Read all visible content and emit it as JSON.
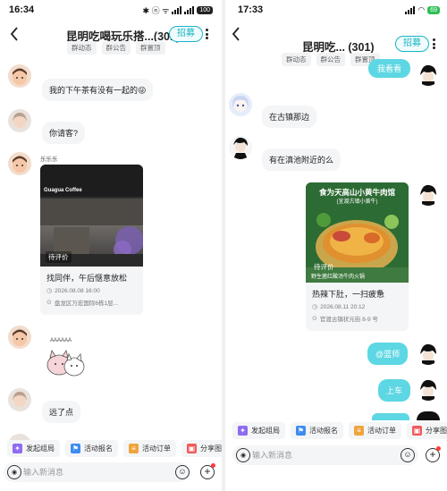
{
  "left": {
    "status": {
      "time": "16:34",
      "icons": "✱ ⓝ ᯤ",
      "battery": "100"
    },
    "header": {
      "title": "昆明吃喝玩乐搭...(301)",
      "recruit_label": "招募",
      "chips": [
        "群动态",
        "群公告",
        "群置顶"
      ]
    },
    "messages": [
      {
        "type": "text",
        "text": "我的下午茶有没有一起的😜"
      },
      {
        "type": "text",
        "text": "你请客?"
      },
      {
        "type": "card",
        "sender": "乐乐乐",
        "photo_text": "Guagua Coffee",
        "tag": "待评价",
        "title": "找同伴，午后惬意放松",
        "time": "2026.08.08 16:00",
        "place": "盘龙区万宏国际6栋1层..."
      },
      {
        "type": "sticker",
        "text": "AAAAAA"
      },
      {
        "type": "text",
        "text": "远了点"
      }
    ],
    "quick_actions": [
      "发起组局",
      "活动报名",
      "活动订单",
      "分享图片"
    ],
    "input_placeholder": "输入新消息"
  },
  "right": {
    "status": {
      "time": "17:33",
      "battery": "69"
    },
    "header": {
      "title": "昆明吃...  (301)",
      "recruit_label": "招募",
      "chips": [
        "群动态",
        "群公告",
        "群置顶"
      ]
    },
    "messages": [
      {
        "type": "text",
        "mine": true,
        "text": "我看看"
      },
      {
        "type": "text",
        "text": "在古镇那边"
      },
      {
        "type": "text",
        "text": "有在滇池附近的么"
      },
      {
        "type": "card",
        "mine": true,
        "poster_line1": "食为天高山小黄牛肉馆",
        "poster_line2": "(宜渡古镇小黄牛)",
        "tag": "待评价",
        "tag2": "野生菌红酸汤牛肉火锅",
        "title": "热辣下肚，一扫疲惫",
        "time": "2026.08.11  20:12",
        "place": "官渡古镇状元街 8-9 号"
      },
      {
        "type": "text",
        "mine": true,
        "text": "@蓝师"
      },
      {
        "type": "text",
        "mine": true,
        "text": "上车"
      }
    ],
    "quick_actions": [
      "发起组局",
      "活动报名",
      "活动订单",
      "分享图片"
    ],
    "input_placeholder": "输入新消息"
  },
  "colors": {
    "accent": "#19b3c4",
    "mine_bubble": "#5dd7e3",
    "other_bubble": "#f4f5f7",
    "badge": "#ff3b3b"
  }
}
